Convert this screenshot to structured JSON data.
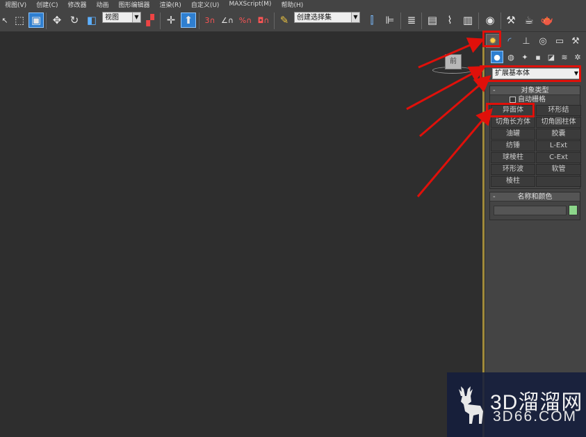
{
  "menu": {
    "items": [
      "视图(V)",
      "创建(C)",
      "修改器",
      "动画",
      "图形编辑器",
      "渲染(R)",
      "自定义(U)",
      "MAXScript(M)",
      "帮助(H)"
    ]
  },
  "toolbar": {
    "view_dropdown": "视图",
    "selection_set": "创建选择集",
    "icons": [
      "select-icon",
      "rect-select-icon",
      "window-crossing-icon",
      "move-icon",
      "rotate-icon",
      "scale-icon",
      "reference-coord-dropdown",
      "pivot-icon",
      "snap-move-icon",
      "select-manipulate-icon",
      "snap-3d-icon",
      "angle-snap-icon",
      "percent-snap-icon",
      "spinner-snap-icon",
      "edit-named-selection-icon",
      "mirror-icon",
      "align-icon",
      "layer-icon",
      "scene-explorer-icon",
      "curve-editor-icon",
      "schematic-view-icon",
      "material-editor-icon",
      "render-setup-icon",
      "rendered-frame-icon",
      "render-icon"
    ]
  },
  "viewport": {
    "viewcube_label": "前"
  },
  "command_panel": {
    "tabs": [
      "create-tab",
      "modify-tab",
      "hierarchy-tab",
      "motion-tab",
      "display-tab",
      "utilities-tab"
    ],
    "subtabs": [
      "geometry",
      "shapes",
      "lights",
      "cameras",
      "helpers",
      "space-warps",
      "systems"
    ],
    "category": "扩展基本体",
    "object_type": {
      "title": "对象类型",
      "autogrid": "自动栅格",
      "buttons": [
        [
          "异面体",
          "环形结"
        ],
        [
          "切角长方体",
          "切角圆柱体"
        ],
        [
          "油罐",
          "胶囊"
        ],
        [
          "纺锤",
          "L-Ext"
        ],
        [
          "球棱柱",
          "C-Ext"
        ],
        [
          "环形波",
          "软管"
        ],
        [
          "棱柱",
          ""
        ]
      ]
    },
    "name_color": {
      "title": "名称和颜色",
      "name_value": "",
      "color": "#8cd68a"
    }
  },
  "annotation_color": "#e0100a",
  "watermark": {
    "brand": "3D溜溜网",
    "domain": "3D66.COM"
  }
}
